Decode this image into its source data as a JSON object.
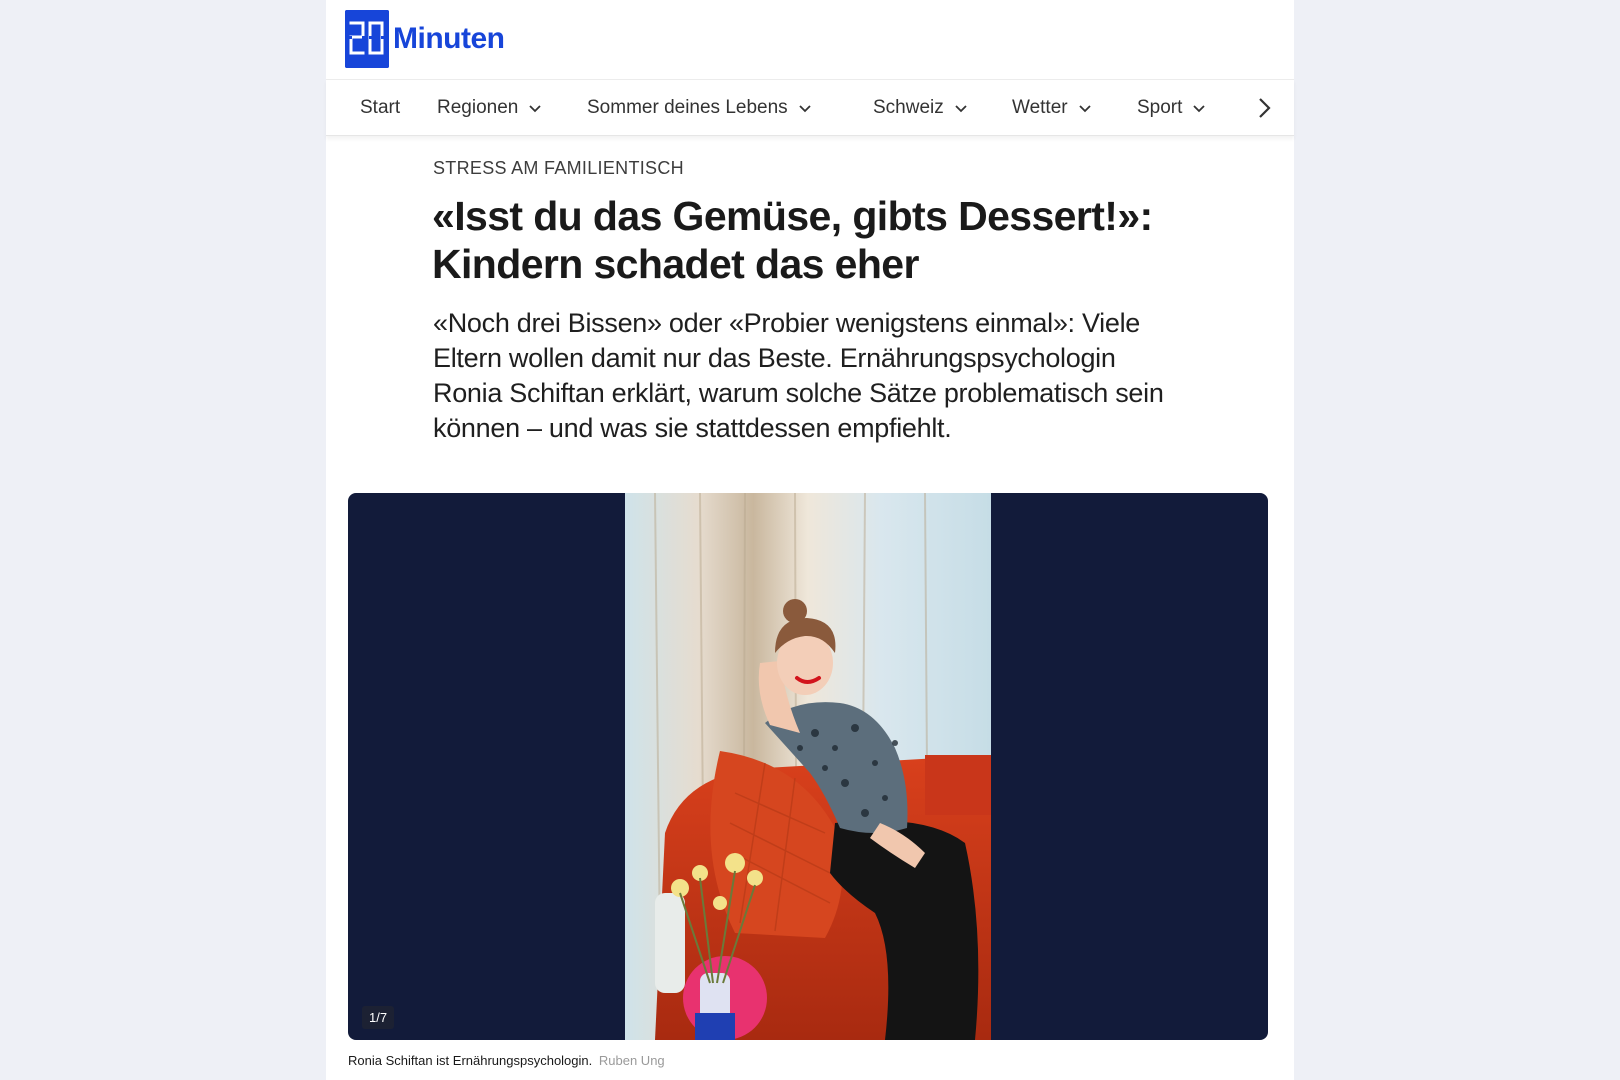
{
  "brand": {
    "logo_text": "Minuten",
    "logo_mark_label": "20",
    "color": "#1745d9"
  },
  "nav": {
    "items": [
      {
        "label": "Start",
        "has_dropdown": false
      },
      {
        "label": "Regionen",
        "has_dropdown": true
      },
      {
        "label": "Sommer deines Lebens",
        "has_dropdown": true
      },
      {
        "label": "Schweiz",
        "has_dropdown": true
      },
      {
        "label": "Wetter",
        "has_dropdown": true
      },
      {
        "label": "Sport",
        "has_dropdown": true
      }
    ],
    "next_icon": "chevron-right-icon"
  },
  "article": {
    "kicker": "STRESS AM FAMILIENTISCH",
    "headline": "«Isst du das Gemüse, gibts Dessert!»: Kindern schadet das eher",
    "lead": "«Noch drei Bissen» oder «Probier wenigstens einmal»: Viele Eltern wollen damit nur das Beste. Ernährungspsychologin Ronia Schiftan erklärt, warum solche Sätze problematisch sein können – und was sie stattdessen empfiehlt."
  },
  "gallery": {
    "counter": "1/7",
    "background": "#121b3a",
    "caption": "Ronia Schiftan ist Ernährungspsychologin.",
    "credit": "Ruben Ung"
  }
}
